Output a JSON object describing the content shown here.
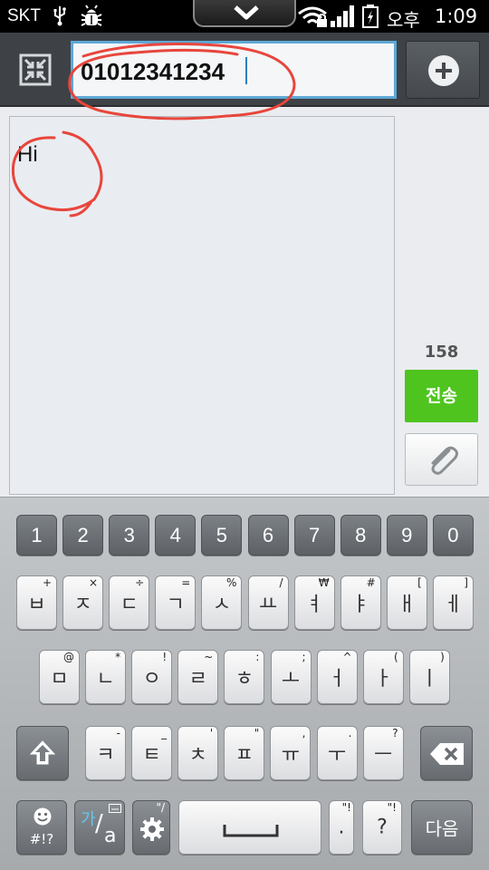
{
  "status_bar": {
    "carrier": "SKT",
    "ampm": "오후",
    "time": "1:09",
    "icons": [
      "usb-icon",
      "debug-bug-icon",
      "pull-down-chevron-icon",
      "wifi-lock-icon",
      "signal-bars-icon",
      "battery-charging-icon"
    ]
  },
  "header": {
    "recipient_value": "01012341234",
    "collapse_icon": "collapse-arrows-icon",
    "add_icon": "plus-circle-icon"
  },
  "compose": {
    "message_text": "Hi",
    "char_count": "158",
    "send_label": "전송",
    "attach_icon": "paperclip-icon",
    "send_color": "#4fc41e"
  },
  "keyboard": {
    "number_row": [
      "1",
      "2",
      "3",
      "4",
      "5",
      "6",
      "7",
      "8",
      "9",
      "0"
    ],
    "row1": [
      {
        "main": "ㅂ",
        "sec": "+"
      },
      {
        "main": "ㅈ",
        "sec": "×"
      },
      {
        "main": "ㄷ",
        "sec": "÷"
      },
      {
        "main": "ㄱ",
        "sec": "="
      },
      {
        "main": "ㅅ",
        "sec": "%"
      },
      {
        "main": "ㅛ",
        "sec": "/"
      },
      {
        "main": "ㅕ",
        "sec": "₩"
      },
      {
        "main": "ㅑ",
        "sec": "#"
      },
      {
        "main": "ㅐ",
        "sec": "["
      },
      {
        "main": "ㅔ",
        "sec": "]"
      }
    ],
    "row2": [
      {
        "main": "ㅁ",
        "sec": "@"
      },
      {
        "main": "ㄴ",
        "sec": "*"
      },
      {
        "main": "ㅇ",
        "sec": "!"
      },
      {
        "main": "ㄹ",
        "sec": "~"
      },
      {
        "main": "ㅎ",
        "sec": ":"
      },
      {
        "main": "ㅗ",
        "sec": ";"
      },
      {
        "main": "ㅓ",
        "sec": "^"
      },
      {
        "main": "ㅏ",
        "sec": "("
      },
      {
        "main": "ㅣ",
        "sec": ")"
      }
    ],
    "row3": [
      {
        "main": "ㅋ",
        "sec": "-"
      },
      {
        "main": "ㅌ",
        "sec": "_"
      },
      {
        "main": "ㅊ",
        "sec": "'"
      },
      {
        "main": "ㅍ",
        "sec": "\""
      },
      {
        "main": "ㅠ",
        "sec": ","
      },
      {
        "main": "ㅜ",
        "sec": "."
      },
      {
        "main": "ㅡ",
        "sec": "?"
      }
    ],
    "symbols_label": "#!?",
    "lang_label_top": "가",
    "lang_label_bottom": "a",
    "period_label": ".",
    "question_label": "?",
    "next_label": "다음",
    "space_icon": "space-bar-icon",
    "shift_icon": "shift-arrow-icon",
    "backspace_icon": "backspace-icon",
    "settings_icon": "gear-icon",
    "emoji_icon": "smiley-icon"
  }
}
